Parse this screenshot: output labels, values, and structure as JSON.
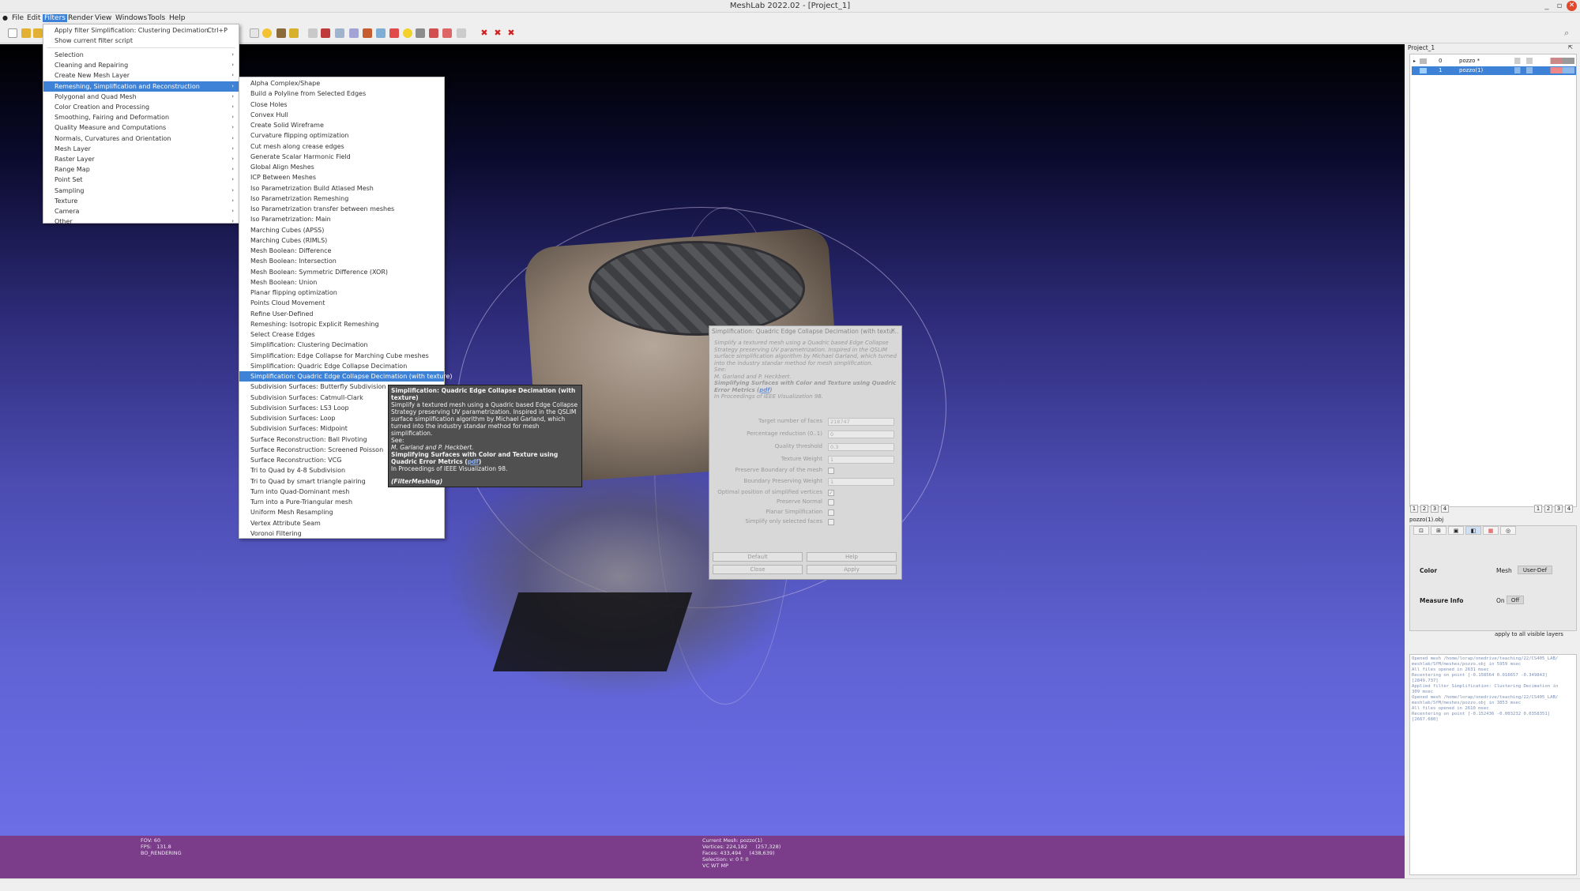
{
  "window": {
    "title": "MeshLab 2022.02 - [Project_1]",
    "minimize": "_",
    "maximize": "▫",
    "close": "✕"
  },
  "menubar": [
    "File",
    "Edit",
    "Filters",
    "Render",
    "View",
    "Windows",
    "Tools",
    "Help"
  ],
  "filters_menu": {
    "top": [
      {
        "label": "Apply filter Simplification: Clustering Decimation",
        "shortcut": "Ctrl+P"
      },
      {
        "label": "Show current filter script",
        "shortcut": ""
      }
    ],
    "categories": [
      "Selection",
      "Cleaning and Repairing",
      "Create New Mesh Layer",
      "Remeshing, Simplification and Reconstruction",
      "Polygonal and Quad Mesh",
      "Color Creation and Processing",
      "Smoothing, Fairing and Deformation",
      "Quality Measure and Computations",
      "Normals, Curvatures and Orientation",
      "Mesh Layer",
      "Raster Layer",
      "Range Map",
      "Point Set",
      "Sampling",
      "Texture",
      "Camera",
      "Other"
    ],
    "selected_index": 3
  },
  "submenu": {
    "items": [
      "Alpha Complex/Shape",
      "Build a Polyline from Selected Edges",
      "Close Holes",
      "Convex Hull",
      "Create Solid Wireframe",
      "Curvature flipping optimization",
      "Cut mesh along crease edges",
      "Generate Scalar Harmonic Field",
      "Global Align Meshes",
      "ICP Between Meshes",
      "Iso Parametrization Build Atlased Mesh",
      "Iso Parametrization Remeshing",
      "Iso Parametrization transfer between meshes",
      "Iso Parametrization: Main",
      "Marching Cubes (APSS)",
      "Marching Cubes (RIMLS)",
      "Mesh Boolean: Difference",
      "Mesh Boolean: Intersection",
      "Mesh Boolean: Symmetric Difference (XOR)",
      "Mesh Boolean: Union",
      "Planar flipping optimization",
      "Points Cloud Movement",
      "Refine User-Defined",
      "Remeshing: Isotropic Explicit Remeshing",
      "Select Crease Edges",
      "Simplification: Clustering Decimation",
      "Simplification: Edge Collapse for Marching Cube meshes",
      "Simplification: Quadric Edge Collapse Decimation",
      "Simplification: Quadric Edge Collapse Decimation (with texture)",
      "Subdivision Surfaces: Butterfly Subdivision",
      "Subdivision Surfaces: Catmull-Clark",
      "Subdivision Surfaces: LS3 Loop",
      "Subdivision Surfaces: Loop",
      "Subdivision Surfaces: Midpoint",
      "Surface Reconstruction: Ball Pivoting",
      "Surface Reconstruction: Screened Poisson",
      "Surface Reconstruction: VCG",
      "Tri to Quad by 4-8 Subdivision",
      "Tri to Quad by smart triangle pairing",
      "Turn into Quad-Dominant mesh",
      "Turn into a Pure-Triangular mesh",
      "Uniform Mesh Resampling",
      "Vertex Attribute Seam",
      "Voronoi Filtering"
    ],
    "selected_index": 28
  },
  "tooltip": {
    "title": "Simplification: Quadric Edge Collapse Decimation (with texture)",
    "body": "Simplify a textured mesh using a Quadric based Edge Collapse Strategy preserving UV parametrization. Inspired in the QSLIM surface simplification algorithm by Michael Garland, which turned into the industry standar method for mesh simplification.",
    "see": "See:",
    "authors": "M. Garland and P. Heckbert.",
    "ref_title": "Simplifying Surfaces with Color and Texture using Quadric Error Metrics (",
    "pdf": "pdf",
    "ref_close": ")",
    "venue": "In Proceedings of IEEE Visualization 98.",
    "plugin": "(FilterMeshing)"
  },
  "dialog": {
    "title": "Simplification: Quadric Edge Collapse Decimation (with textu...",
    "close": "✕",
    "desc1": "Simplify a textured mesh using a Quadric based Edge Collapse Strategy preserving UV parametrization. Inspired in the QSLIM surface simplification algorithm by Michael Garland, which turned into the industry standar method for mesh simplification.",
    "see": "See:",
    "authors": "M. Garland and P. Heckbert.",
    "ref_title": "Simplifying Surfaces with Color and Texture using Quadric Error Metrics (",
    "pdf": "pdf",
    "ref_close": ")",
    "venue": "In Proceedings of IEEE Visualization 98.",
    "fields": [
      {
        "label": "Target number of faces",
        "value": "218747"
      },
      {
        "label": "Percentage reduction (0..1)",
        "value": "0"
      },
      {
        "label": "Quality threshold",
        "value": "0.3"
      },
      {
        "label": "Texture Weight",
        "value": "1"
      }
    ],
    "checks1": [
      {
        "label": "Preserve Boundary of the mesh",
        "checked": false
      }
    ],
    "field2": {
      "label": "Boundary Preserving Weight",
      "value": "1"
    },
    "checks2": [
      {
        "label": "Optimal position of simplified vertices",
        "checked": true
      },
      {
        "label": "Preserve Normal",
        "checked": false
      },
      {
        "label": "Planar Simplification",
        "checked": false
      },
      {
        "label": "Simplify only selected faces",
        "checked": false
      }
    ],
    "buttons": {
      "default": "Default",
      "help": "Help",
      "close": "Close",
      "apply": "Apply"
    }
  },
  "status": {
    "left": [
      "FOV: 60",
      "FPS:   131.8",
      "BO_RENDERING"
    ],
    "center": [
      "Current Mesh: pozzo(1)",
      "Vertices: 224,182     (257,328)",
      "Faces: 433,494     (438,639)",
      "Selection: v: 0 f: 0",
      "VC WT MP"
    ]
  },
  "right": {
    "project": "Project_1",
    "panel_pin": "⇱",
    "layers": [
      {
        "num": "0",
        "name": "pozzo *",
        "selected": false
      },
      {
        "num": "1",
        "name": "pozzo(1)",
        "selected": true
      }
    ],
    "layer_toggle": "▸",
    "pager_left": [
      "1",
      "2",
      "3",
      "4"
    ],
    "pager_right": [
      "1",
      "2",
      "3",
      "4"
    ],
    "file": "pozzo(1).obj",
    "color_label": "Color",
    "mesh_label": "Mesh",
    "userdef": "User-Def",
    "measure_label": "Measure Info",
    "on": "On",
    "off": "Off",
    "apply_all": "apply to all visible layers",
    "log": [
      "Opened mesh /home/lorap/onedrive/teaching/22/CS405_LAB/",
      "meshlab/SfM/meshes/pozzo.obj in 5959 msec",
      "All files opened in 2631 msec",
      "Recentering on point [-0.158564 0.016657 -0.349843]",
      "[2849.737]",
      "Applied filter Simplification: Clustering Decimation in",
      "309 msec",
      "Opened mesh /home/lorap/onedrive/teaching/22/CS405_LAB/",
      "meshlab/SfM/meshes/pozzo.obj in 3853 msec",
      "All files opened in 2610 msec",
      "Recentering on point [-0.152436 -0.003232 0.0358351]",
      "[2667.680]"
    ]
  },
  "colors": {
    "accent": "#3d82d6",
    "status_bg": "#7b3d8a",
    "viewport_top": "#000000",
    "viewport_bottom": "#6c6ee6"
  }
}
